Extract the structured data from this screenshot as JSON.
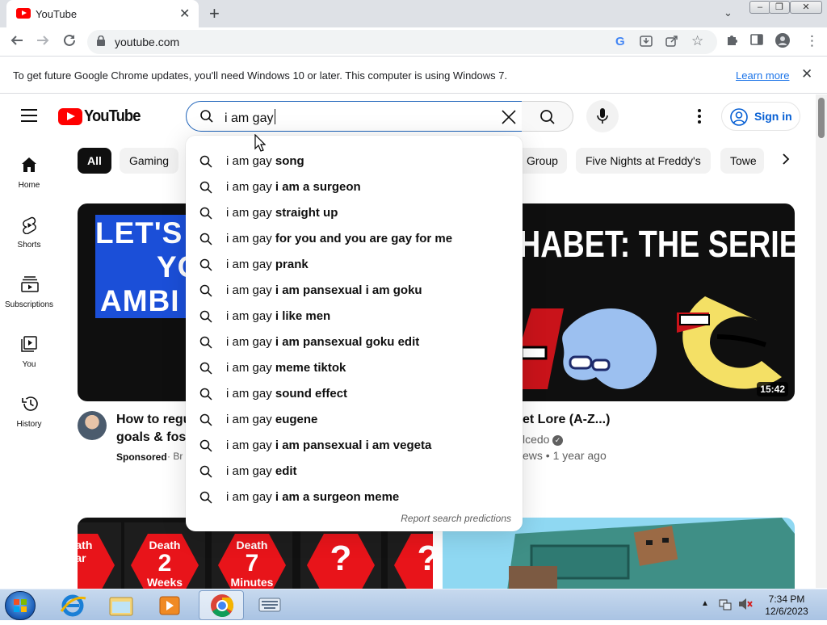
{
  "browser": {
    "tab_title": "YouTube",
    "url": "youtube.com",
    "infobar_message": "To get future Google Chrome updates, you'll need Windows 10 or later. This computer is using Windows 7.",
    "infobar_link": "Learn more"
  },
  "header": {
    "logo_text": "YouTube",
    "search_query": "i am gay",
    "sign_in_label": "Sign in"
  },
  "sidebar": {
    "items": [
      {
        "label": "Home",
        "icon": "home-icon"
      },
      {
        "label": "Shorts",
        "icon": "shorts-icon"
      },
      {
        "label": "Subscriptions",
        "icon": "subscriptions-icon"
      },
      {
        "label": "You",
        "icon": "you-icon"
      },
      {
        "label": "History",
        "icon": "history-icon"
      }
    ]
  },
  "chips": [
    "All",
    "Gaming",
    "Group",
    "Five Nights at Freddy's",
    "Towe"
  ],
  "suggestions": {
    "prefix": "i am gay",
    "items": [
      {
        "plain": "song",
        "bold": false
      },
      {
        "plain": "i am a surgeon",
        "bold": true
      },
      {
        "plain": "straight up",
        "bold": false
      },
      {
        "plain": "for you and you are gay for me",
        "bold": true
      },
      {
        "plain": "prank",
        "bold": false
      },
      {
        "plain": "i am pansexual i am goku",
        "bold": true
      },
      {
        "plain": "i like men",
        "bold": true
      },
      {
        "plain": "i am pansexual goku edit",
        "bold": true
      },
      {
        "plain": "meme tiktok",
        "bold": false
      },
      {
        "plain": "sound effect",
        "bold": false
      },
      {
        "plain": "eugene",
        "bold": false
      },
      {
        "plain": "i am pansexual i am vegeta",
        "bold": true
      },
      {
        "plain": "edit",
        "bold": false
      },
      {
        "plain": "i am a surgeon meme",
        "bold": true
      }
    ],
    "report": "Report search predictions"
  },
  "videos": [
    {
      "thumb_lines": [
        "LET'S I",
        "YO",
        "AMBI"
      ],
      "title_lines": [
        "How to regu",
        "goals & fost"
      ],
      "sponsored": "Sponsored",
      "channel_fragment": "· Br"
    },
    {
      "thumb_title": "HABET: THE SERIES",
      "duration": "15:42",
      "title": "et Lore (A-Z...)",
      "channel": "lcedo",
      "meta": "ews • 1 year ago"
    }
  ],
  "bottom_row": {
    "tiles": [
      {
        "a": "eath",
        "b": "",
        "c": "ar"
      },
      {
        "a": "Death",
        "b": "2",
        "c": "Weeks"
      },
      {
        "a": "Death",
        "b": "7",
        "c": "Minutes"
      },
      {
        "a": "",
        "b": "?",
        "c": ""
      },
      {
        "a": "",
        "b": "?",
        "c": ""
      }
    ]
  },
  "taskbar": {
    "time": "7:34 PM",
    "date": "12/6/2023"
  },
  "colors": {
    "youtube_red": "#ff0000",
    "link_blue": "#065fd4",
    "search_border": "#1c62b9"
  }
}
